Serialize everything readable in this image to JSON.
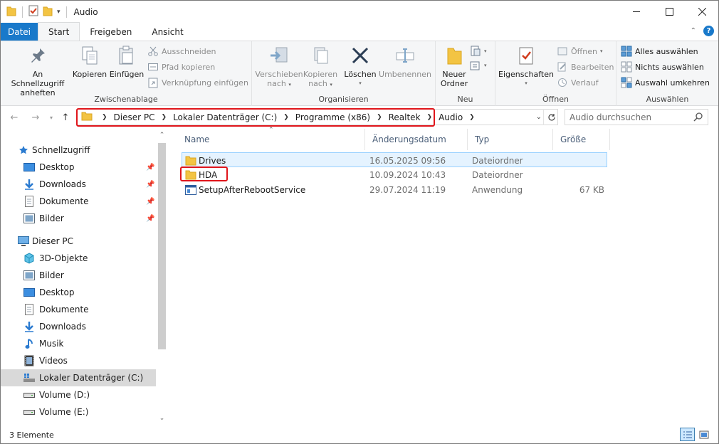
{
  "window": {
    "title": "Audio",
    "controls": [
      "minimize",
      "maximize",
      "close"
    ]
  },
  "ribbon_tabs": [
    "Datei",
    "Start",
    "Freigeben",
    "Ansicht"
  ],
  "ribbon": {
    "zwischenablage": {
      "label": "Zwischenablage",
      "pin_label_1": "An Schnellzugriff",
      "pin_label_2": "anheften",
      "copy": "Kopieren",
      "paste": "Einfügen",
      "cut": "Ausschneiden",
      "copy_path": "Pfad kopieren",
      "paste_shortcut": "Verknüpfung einfügen"
    },
    "organisieren": {
      "label": "Organisieren",
      "move_1": "Verschieben",
      "move_2": "nach",
      "copyto_1": "Kopieren",
      "copyto_2": "nach",
      "delete": "Löschen",
      "rename": "Umbenennen"
    },
    "neu": {
      "label": "Neu",
      "new_folder_1": "Neuer",
      "new_folder_2": "Ordner"
    },
    "oeffnen": {
      "label": "Öffnen",
      "properties": "Eigenschaften",
      "open": "Öffnen",
      "edit": "Bearbeiten",
      "history": "Verlauf"
    },
    "auswaehlen": {
      "label": "Auswählen",
      "select_all": "Alles auswählen",
      "select_none": "Nichts auswählen",
      "invert": "Auswahl umkehren"
    }
  },
  "address": {
    "crumbs": [
      "Dieser PC",
      "Lokaler Datenträger (C:)",
      "Programme (x86)",
      "Realtek",
      "Audio"
    ]
  },
  "search": {
    "placeholder": "Audio durchsuchen"
  },
  "nav": {
    "quick_access": "Schnellzugriff",
    "quick_items": [
      "Desktop",
      "Downloads",
      "Dokumente",
      "Bilder"
    ],
    "this_pc": "Dieser PC",
    "pc_items": [
      "3D-Objekte",
      "Bilder",
      "Desktop",
      "Dokumente",
      "Downloads",
      "Musik",
      "Videos",
      "Lokaler Datenträger (C:)",
      "Volume (D:)",
      "Volume (E:)"
    ]
  },
  "columns": [
    "Name",
    "Änderungsdatum",
    "Typ",
    "Größe"
  ],
  "files": [
    {
      "name": "Drives",
      "date": "16.05.2025 09:56",
      "type": "Dateiordner",
      "size": ""
    },
    {
      "name": "HDA",
      "date": "10.09.2024 10:43",
      "type": "Dateiordner",
      "size": ""
    },
    {
      "name": "SetupAfterRebootService",
      "date": "29.07.2024 11:19",
      "type": "Anwendung",
      "size": "67 KB"
    }
  ],
  "status": {
    "count": "3 Elemente"
  },
  "colors": {
    "accent": "#1979ca",
    "highlight": "#e0151b",
    "folder": "#f3c443"
  }
}
